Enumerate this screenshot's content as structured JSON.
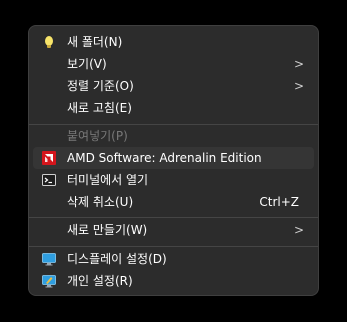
{
  "menu": {
    "items": [
      {
        "label": "새 폴더(N)",
        "icon": "lightbulb-icon"
      },
      {
        "label": "보기(V)",
        "submenu": ">"
      },
      {
        "label": "정렬 기준(O)",
        "submenu": ">"
      },
      {
        "label": "새로 고침(E)"
      },
      {
        "label": "붙여넣기(P)",
        "disabled": true
      },
      {
        "label": "AMD Software: Adrenalin Edition",
        "icon": "amd-logo-icon"
      },
      {
        "label": "터미널에서 열기",
        "icon": "terminal-icon"
      },
      {
        "label": "삭제 취소(U)",
        "shortcut": "Ctrl+Z"
      },
      {
        "label": "새로 만들기(W)",
        "submenu": ">"
      },
      {
        "label": "디스플레이 설정(D)",
        "icon": "display-icon"
      },
      {
        "label": "개인 설정(R)",
        "icon": "personalize-icon"
      }
    ]
  },
  "colors": {
    "menu_bg": "#2c2c2c",
    "text": "#ffffff",
    "disabled_text": "#787878",
    "amd_red": "#d4151c",
    "icon_blue": "#2f9ee0"
  }
}
